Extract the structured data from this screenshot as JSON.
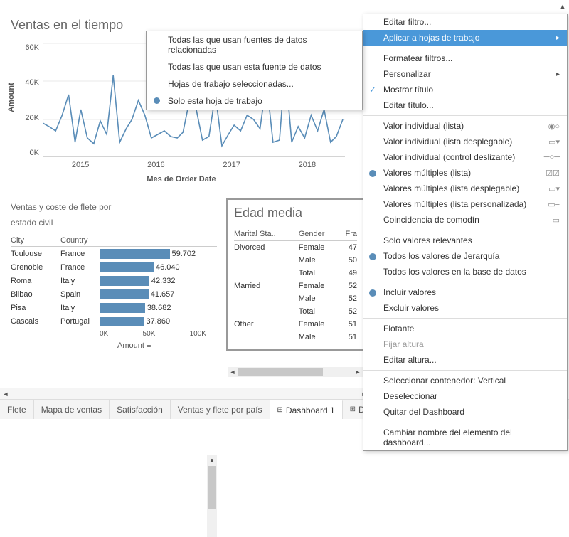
{
  "chart1": {
    "title": "Ventas en el tiempo",
    "ylabel": "Amount",
    "yticks": [
      "60K",
      "40K",
      "20K",
      "0K"
    ],
    "xticks": [
      "2015",
      "2016",
      "2017",
      "2018"
    ],
    "xlabel": "Mes de Order Date"
  },
  "chart2": {
    "title_l1": "Ventas y coste de flete por",
    "title_l2": "estado civil",
    "header_city": "City",
    "header_country": "Country",
    "xticks": [
      "0K",
      "50K",
      "100K"
    ],
    "xlabel": "Amount ≡",
    "rows": [
      {
        "city": "Toulouse",
        "country": "France",
        "label": "59.702"
      },
      {
        "city": "Grenoble",
        "country": "France",
        "label": "46.040"
      },
      {
        "city": "Roma",
        "country": "Italy",
        "label": "42.332"
      },
      {
        "city": "Bilbao",
        "country": "Spain",
        "label": "41.657"
      },
      {
        "city": "Pisa",
        "country": "Italy",
        "label": "38.682"
      },
      {
        "city": "Cascais",
        "country": "Portugal",
        "label": "37.860"
      }
    ]
  },
  "chart3": {
    "title": "Edad media",
    "h1": "Marital Sta..",
    "h2": "Gender",
    "h3": "Fra",
    "rows": [
      {
        "m": "Divorced",
        "g": "Female",
        "v": "47"
      },
      {
        "m": "",
        "g": "Male",
        "v": "50"
      },
      {
        "m": "",
        "g": "Total",
        "v": "49"
      },
      {
        "m": "Married",
        "g": "Female",
        "v": "52"
      },
      {
        "m": "",
        "g": "Male",
        "v": "52"
      },
      {
        "m": "",
        "g": "Total",
        "v": "52"
      },
      {
        "m": "Other",
        "g": "Female",
        "v": "51"
      },
      {
        "m": "",
        "g": "Male",
        "v": "51"
      }
    ]
  },
  "tabs": {
    "t0": "Flete",
    "t1": "Mapa de ventas",
    "t2": "Satisfacción",
    "t3": "Ventas y flete por país",
    "t4": "Dashboard 1",
    "t5": "Dash"
  },
  "submenu": {
    "i0": "Todas las que usan fuentes de datos relacionadas",
    "i1": "Todas las que usan esta fuente de datos",
    "i2": "Hojas de trabajo seleccionadas...",
    "i3": "Solo esta hoja de trabajo"
  },
  "menu": {
    "m0": "Editar filtro...",
    "m1": "Aplicar a hojas de trabajo",
    "m2": "Formatear filtros...",
    "m3": "Personalizar",
    "m4": "Mostrar título",
    "m5": "Editar título...",
    "m6": "Valor individual (lista)",
    "m7": "Valor individual (lista desplegable)",
    "m8": "Valor individual (control deslizante)",
    "m9": "Valores múltiples (lista)",
    "m10": "Valores múltiples (lista desplegable)",
    "m11": "Valores múltiples (lista personalizada)",
    "m12": "Coincidencia de comodín",
    "m13": "Solo valores relevantes",
    "m14": "Todos los valores de Jerarquía",
    "m15": "Todos los valores en la base de datos",
    "m16": "Incluir valores",
    "m17": "Excluir valores",
    "m18": "Flotante",
    "m19": "Fijar altura",
    "m20": "Editar altura...",
    "m21": "Seleccionar contenedor: Vertical",
    "m22": "Deseleccionar",
    "m23": "Quitar del Dashboard",
    "m24": "Cambiar nombre del elemento del dashboard..."
  },
  "chart_data": [
    {
      "type": "line",
      "title": "Ventas en el tiempo",
      "xlabel": "Mes de Order Date",
      "ylabel": "Amount",
      "ylim": [
        0,
        60000
      ],
      "categories": [
        "2015-01",
        "2015-02",
        "2015-03",
        "2015-04",
        "2015-05",
        "2015-06",
        "2015-07",
        "2015-08",
        "2015-09",
        "2015-10",
        "2015-11",
        "2015-12",
        "2016-01",
        "2016-02",
        "2016-03",
        "2016-04",
        "2016-05",
        "2016-06",
        "2016-07",
        "2016-08",
        "2016-09",
        "2016-10",
        "2016-11",
        "2016-12",
        "2017-01",
        "2017-02",
        "2017-03",
        "2017-04",
        "2017-05",
        "2017-06",
        "2017-07",
        "2017-08",
        "2017-09",
        "2017-10",
        "2017-11",
        "2017-12",
        "2018-01",
        "2018-02",
        "2018-03",
        "2018-04",
        "2018-05",
        "2018-06",
        "2018-07",
        "2018-08",
        "2018-09",
        "2018-10",
        "2018-11",
        "2018-12"
      ],
      "values": [
        18000,
        16000,
        14000,
        22000,
        33000,
        8000,
        25000,
        10000,
        7000,
        19000,
        12000,
        43000,
        8000,
        15000,
        20000,
        30000,
        22000,
        10000,
        12000,
        14000,
        11000,
        10000,
        13000,
        30000,
        26000,
        9000,
        11000,
        33000,
        6000,
        12000,
        17000,
        14000,
        22000,
        20000,
        15000,
        40000,
        8000,
        9000,
        48000,
        8000,
        16000,
        10000,
        22000,
        14000,
        25000,
        8000,
        11000,
        20000
      ]
    },
    {
      "type": "bar",
      "title": "Ventas y coste de flete por estado civil",
      "xlabel": "Amount",
      "xlim": [
        0,
        100000
      ],
      "categories": [
        "Toulouse",
        "Grenoble",
        "Roma",
        "Bilbao",
        "Pisa",
        "Cascais"
      ],
      "values": [
        59702,
        46040,
        42332,
        41657,
        38682,
        37860
      ]
    },
    {
      "type": "table",
      "title": "Edad media",
      "columns": [
        "Marital Status",
        "Gender",
        "France"
      ],
      "rows": [
        [
          "Divorced",
          "Female",
          47
        ],
        [
          "Divorced",
          "Male",
          50
        ],
        [
          "Divorced",
          "Total",
          49
        ],
        [
          "Married",
          "Female",
          52
        ],
        [
          "Married",
          "Male",
          52
        ],
        [
          "Married",
          "Total",
          52
        ],
        [
          "Other",
          "Female",
          51
        ],
        [
          "Other",
          "Male",
          51
        ]
      ]
    }
  ]
}
